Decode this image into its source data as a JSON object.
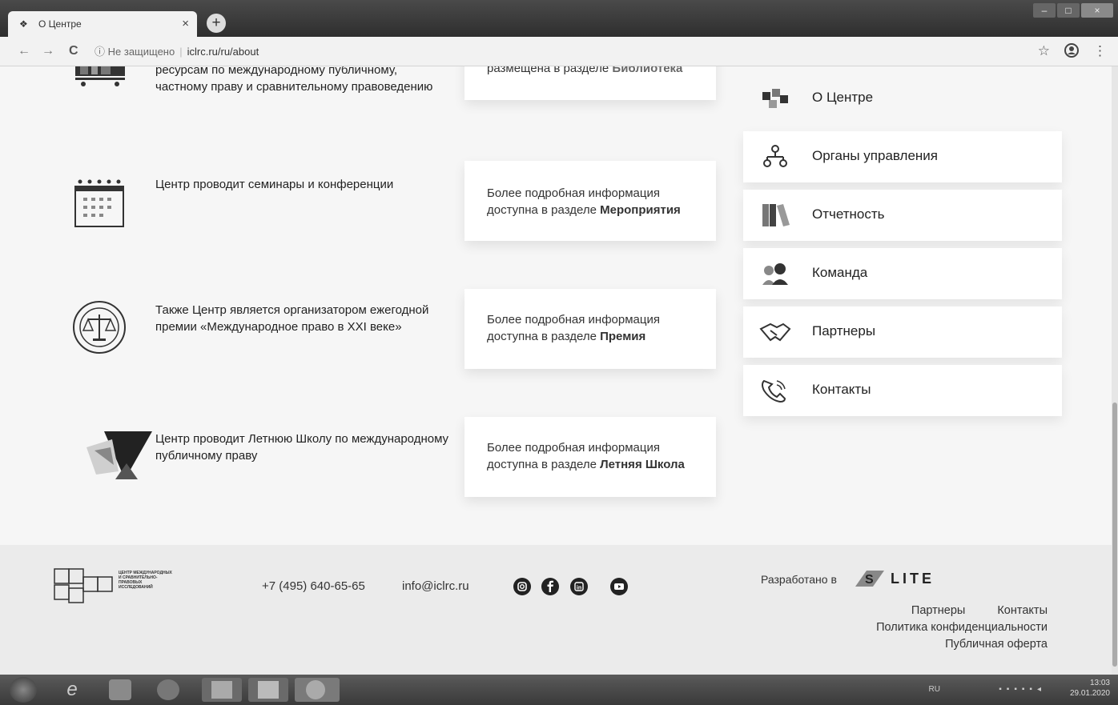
{
  "browser": {
    "tab_title": "О Центре",
    "new_tab": "+",
    "close": "×",
    "security_label": "Не защищено",
    "url": "iclrc.ru/ru/about",
    "back": "←",
    "forward": "→",
    "reload": "C",
    "info": "ⓘ",
    "star": "☆",
    "menu": "⋮",
    "window_controls": [
      "–",
      "□",
      "×"
    ]
  },
  "features": [
    {
      "text": "ресурсам по международному публичному, частному праву и сравнительному правоведению",
      "card_prefix": "размещена в разделе ",
      "card_link": "Библиотека",
      "icon": "library-icon"
    },
    {
      "text": "Центр проводит семинары и конференции",
      "card_prefix": "Более подробная информация доступна в разделе ",
      "card_link": "Мероприятия",
      "icon": "calendar-icon"
    },
    {
      "text": "Также Центр является организатором ежегодной премии «Международное право в XXI веке»",
      "card_prefix": "Более подробная информация доступна в разделе ",
      "card_link": "Премия",
      "icon": "scales-seal-icon"
    },
    {
      "text": "Центр проводит Летнюю Школу по международному публичному праву",
      "card_prefix": "Более подробная информация доступна в разделе ",
      "card_link": "Летняя Школа",
      "icon": "summer-school-icon"
    }
  ],
  "side_menu": [
    {
      "label": "О Центре",
      "icon": "cubes-icon"
    },
    {
      "label": "Органы управления",
      "icon": "hierarchy-icon"
    },
    {
      "label": "Отчетность",
      "icon": "books-icon"
    },
    {
      "label": "Команда",
      "icon": "team-icon"
    },
    {
      "label": "Партнеры",
      "icon": "handshake-icon"
    },
    {
      "label": "Контакты",
      "icon": "phone-icon"
    }
  ],
  "footer": {
    "logo_text": [
      "ЦЕНТР МЕЖДУНАРОДНЫХ",
      "И СРАВНИТЕЛЬНО-",
      "ПРАВОВЫХ",
      "ИССЛЕДОВАНИЙ"
    ],
    "phone": "+7 (495) 640-65-65",
    "email": "info@iclrc.ru",
    "social": [
      "instagram-icon",
      "facebook-icon",
      "linkedin-icon",
      "youtube-icon"
    ],
    "developed_by": "Разработано в",
    "developer": "LITE",
    "links": {
      "partners": "Партнеры",
      "contacts": "Контакты",
      "privacy": "Политика конфиденциальности",
      "offer": "Публичная оферта"
    }
  },
  "taskbar": {
    "lang": "RU",
    "time": "13:03",
    "date": "29.01.2020"
  }
}
